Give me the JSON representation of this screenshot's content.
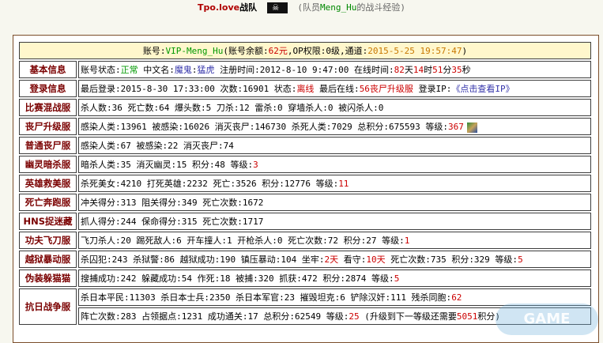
{
  "header": {
    "team_name": "Tpo.love",
    "team_suffix": "战队",
    "sub_prefix": "(队员",
    "player_name": "Meng_Hu",
    "sub_suffix": "的战斗经验)"
  },
  "account": {
    "label": "账号:",
    "id": "VIP-Meng_Hu",
    "balance_label": "(账号余额:",
    "balance": "62元",
    "op_label": ",OP权限:",
    "op": "0级",
    "channel_label": ",通道:",
    "datetime": "2015-5-25 19:57:47",
    "close": ")"
  },
  "rows": [
    {
      "label": "基本信息",
      "segments": [
        {
          "t": "账号状态:"
        },
        {
          "t": "正常",
          "c": "g"
        },
        {
          "t": " 中文名:"
        },
        {
          "t": "魔鬼",
          "c": "p"
        },
        {
          "t": ":"
        },
        {
          "t": "猛虎",
          "c": "p"
        },
        {
          "t": " 注册时间:2012-8-10 9:47:00 在线时间:"
        },
        {
          "t": "82",
          "c": "r"
        },
        {
          "t": "天"
        },
        {
          "t": "14",
          "c": "r"
        },
        {
          "t": "时"
        },
        {
          "t": "51",
          "c": "r"
        },
        {
          "t": "分"
        },
        {
          "t": "35",
          "c": "r"
        },
        {
          "t": "秒"
        }
      ]
    },
    {
      "label": "登录信息",
      "segments": [
        {
          "t": "最后登录:2015-8-30 17:33:00 次数:16901 状态:"
        },
        {
          "t": "离线",
          "c": "r"
        },
        {
          "t": " 最后在线:"
        },
        {
          "t": "56丧尸升级服",
          "c": "r"
        },
        {
          "t": " 登录IP:"
        },
        {
          "t": "《点击查看IP》",
          "c": "p"
        }
      ]
    },
    {
      "label": "比赛混战服",
      "segments": [
        {
          "t": "杀人数:36 死亡数:64 爆头数:5 刀杀:12 雷杀:0 穿墙杀人:0 被闪杀人:0"
        }
      ]
    },
    {
      "label": "丧尸升级服",
      "segments": [
        {
          "t": "感染人类:13961 被感染:16026 消灭丧尸:146730 杀死人类:7029 总积分:675593 等级:"
        },
        {
          "t": "367",
          "c": "r"
        }
      ],
      "avatar": true
    },
    {
      "label": "普通丧尸服",
      "segments": [
        {
          "t": "感染人类:67 被感染:22 消灭丧尸:74"
        }
      ]
    },
    {
      "label": "幽灵暗杀服",
      "segments": [
        {
          "t": "暗杀人类:35 消灭幽灵:15 积分:48 等级:"
        },
        {
          "t": "3",
          "c": "r"
        }
      ]
    },
    {
      "label": "英雄救美服",
      "segments": [
        {
          "t": "杀死美女:4210 打死英雄:2232 死亡:3526 积分:12776 等级:"
        },
        {
          "t": "11",
          "c": "r"
        }
      ]
    },
    {
      "label": "死亡奔跑服",
      "segments": [
        {
          "t": "冲关得分:313 阻关得分:349 死亡次数:1672"
        }
      ]
    },
    {
      "label": "HNS捉迷藏",
      "segments": [
        {
          "t": "抓人得分:244 保命得分:315 死亡次数:1717"
        }
      ]
    },
    {
      "label": "功夫飞刀服",
      "segments": [
        {
          "t": "飞刀杀人:20 踢死敌人:6 开车撞人:1 开枪杀人:0 死亡次数:72 积分:27 等级:"
        },
        {
          "t": "1",
          "c": "r"
        }
      ]
    },
    {
      "label": "越狱暴动服",
      "segments": [
        {
          "t": "杀囚犯:243 杀狱警:86 越狱成功:190 镇压暴动:104 坐牢:"
        },
        {
          "t": "2天",
          "c": "r"
        },
        {
          "t": " 看守:"
        },
        {
          "t": "10天",
          "c": "r"
        },
        {
          "t": " 死亡次数:735 积分:329 等级:"
        },
        {
          "t": "5",
          "c": "r"
        }
      ]
    },
    {
      "label": "伪装躲猫猫",
      "segments": [
        {
          "t": "搜捕成功:242 躲藏成功:54 作死:18 被捕:320 抓获:472 积分:2874 等级:"
        },
        {
          "t": "5",
          "c": "r"
        }
      ]
    }
  ],
  "last_row": {
    "label": "抗日战争服",
    "line1": [
      {
        "t": "杀日本平民:11303 杀日本士兵:2350 杀日本军官:23 摧毁坦克:6 铲除汉奸:111 残杀同胞:"
      },
      {
        "t": "62",
        "c": "r"
      }
    ],
    "line2": [
      {
        "t": "阵亡次数:283 占领据点:1231 成功通关:17 总积分:62549 等级:"
      },
      {
        "t": "25",
        "c": "r"
      },
      {
        "t": " (升级到下一等级还需要"
      },
      {
        "t": "5051",
        "c": "r"
      },
      {
        "t": "积分)"
      }
    ]
  },
  "colors": {
    "label": "#7a0000",
    "header_bg": "#fff7cc",
    "accent_red": "#cc0000",
    "accent_green": "#009900",
    "link": "#3333aa"
  }
}
